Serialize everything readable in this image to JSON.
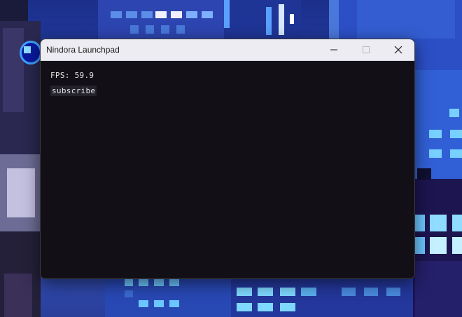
{
  "window": {
    "title": "Nindora Launchpad",
    "controls": {
      "minimize_icon": "minimize-icon",
      "maximize_icon": "maximize-icon",
      "close_icon": "close-icon"
    }
  },
  "content": {
    "fps_label": "FPS: 59.9",
    "subscribe_label": "subscribe"
  },
  "colors": {
    "titlebar_bg": "#ececf2",
    "content_bg": "#121016",
    "text": "#e6e6e6",
    "wallpaper_sky": "#2b49b8",
    "window_lights": "#7fd8ff"
  }
}
